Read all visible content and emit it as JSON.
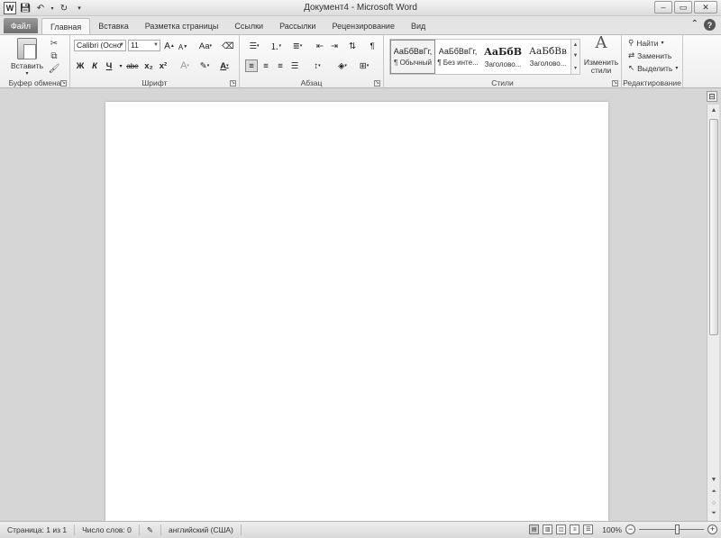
{
  "window": {
    "title": "Документ4 - Microsoft Word",
    "logo_letter": "W"
  },
  "tabs": {
    "file": "Файл",
    "items": [
      "Главная",
      "Вставка",
      "Разметка страницы",
      "Ссылки",
      "Рассылки",
      "Рецензирование",
      "Вид"
    ],
    "active": "Главная"
  },
  "ribbon": {
    "clipboard": {
      "label": "Буфер обмена",
      "paste": "Вставить"
    },
    "font": {
      "label": "Шрифт",
      "family": "Calibri (Осно",
      "size": "11",
      "bold": "Ж",
      "italic": "К",
      "underline": "Ч",
      "strike": "abe",
      "sub": "x₂",
      "sup": "x²",
      "grow": "A",
      "shrink": "A",
      "case": "Aa",
      "color": "A"
    },
    "paragraph": {
      "label": "Абзац",
      "pilcrow": "¶"
    },
    "styles": {
      "label": "Стили",
      "items": [
        {
          "preview": "АаБбВвГг,",
          "name": "¶ Обычный"
        },
        {
          "preview": "АаБбВвГг,",
          "name": "¶ Без инте..."
        },
        {
          "preview": "АаБбВ",
          "name": "Заголово..."
        },
        {
          "preview": "АаБбВв",
          "name": "Заголово..."
        }
      ],
      "change_line1": "Изменить",
      "change_line2": "стили"
    },
    "editing": {
      "label": "Редактирование",
      "find": "Найти",
      "replace": "Заменить",
      "select": "Выделить"
    }
  },
  "status": {
    "page": "Страница: 1 из 1",
    "words": "Число слов: 0",
    "language": "английский (США)",
    "zoom": "100%",
    "zoom_fraction": 0.6
  }
}
